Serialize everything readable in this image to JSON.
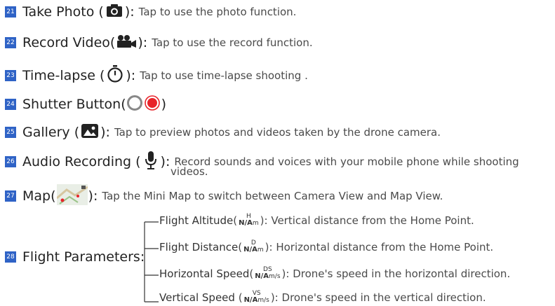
{
  "items": [
    {
      "num": "21",
      "title": "Take Photo",
      "desc": "Tap to use the photo function."
    },
    {
      "num": "22",
      "title": "Record Video",
      "desc": "Tap to use the record function."
    },
    {
      "num": "23",
      "title": "Time-lapse",
      "desc": "Tap to use time-lapse shooting ."
    },
    {
      "num": "24",
      "title": "Shutter Button"
    },
    {
      "num": "25",
      "title": "Gallery",
      "desc": "Tap to preview photos and videos taken by the drone camera."
    },
    {
      "num": "26",
      "title": "Audio Recording",
      "desc_line1": "Record sounds and voices with your mobile phone while shooting",
      "desc_line2": "videos."
    },
    {
      "num": "27",
      "title": "Map",
      "desc": "Tap the Mini Map to switch between Camera View and Map View."
    }
  ],
  "flight": {
    "num": "28",
    "title": "Flight Parameters:",
    "params": [
      {
        "name": "Flight Altitude",
        "unit_top": "H",
        "unit_value": "N/A",
        "unit_suffix": "m",
        "desc": "Vertical distance from the Home Point."
      },
      {
        "name": "Flight Distance",
        "unit_top": "D",
        "unit_value": "N/A",
        "unit_suffix": "m",
        "desc": "Horizontal distance from the Home Point."
      },
      {
        "name": "Horizontal Speed",
        "unit_top": "DS",
        "unit_value": "N/A",
        "unit_suffix": "m/s",
        "desc": "Drone's speed in the horizontal direction."
      },
      {
        "name": "Vertical Speed",
        "unit_top": "VS",
        "unit_value": "N/A",
        "unit_suffix": "m/s",
        "desc": "Drone's speed in the vertical direction."
      }
    ]
  },
  "colors": {
    "badge": "#2f63c6",
    "shutter_red": "#e8232a"
  },
  "icons": [
    "camera-icon",
    "video-camera-icon",
    "timer-icon",
    "shutter-icons",
    "gallery-icon",
    "microphone-icon",
    "mini-map-icon"
  ]
}
